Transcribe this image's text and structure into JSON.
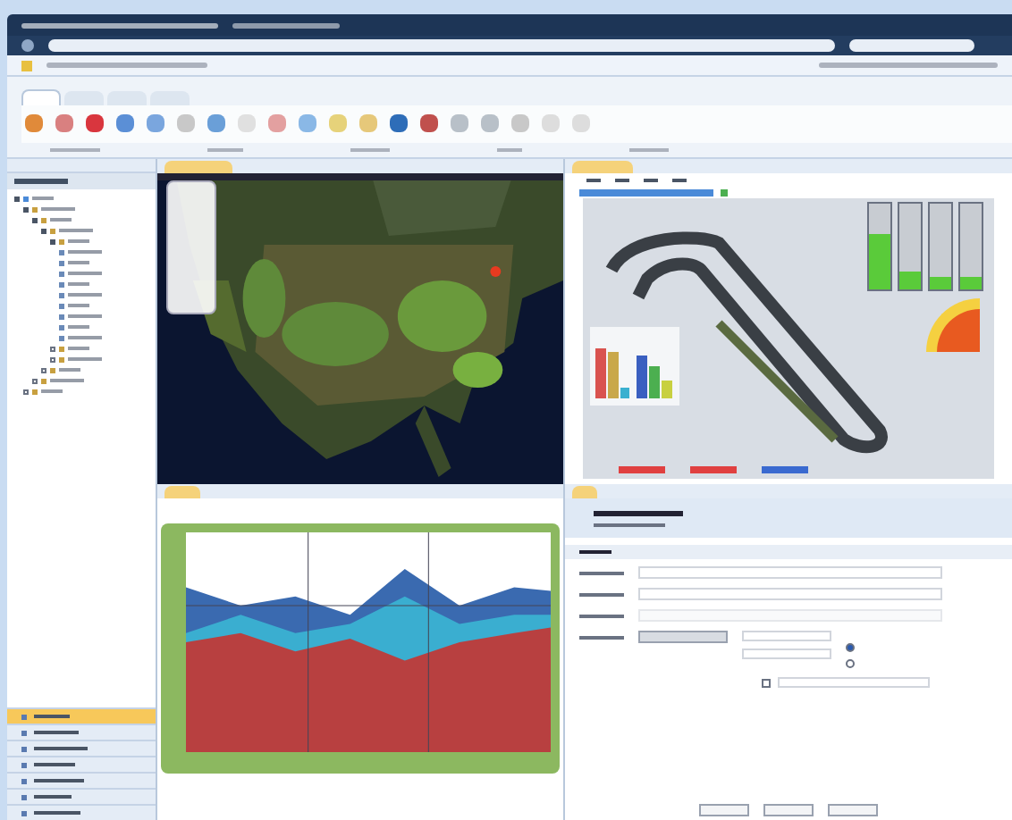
{
  "ribbon": {
    "tabs": [
      {
        "selected": true
      },
      {
        "selected": false
      },
      {
        "selected": false
      },
      {
        "selected": false
      }
    ],
    "buttons": [
      {
        "color": "#e08a3a"
      },
      {
        "color": "#d98080"
      },
      {
        "color": "#d9363e"
      },
      {
        "color": "#5b8fd6"
      },
      {
        "color": "#7aa6de"
      },
      {
        "color": "#c8c8c8"
      },
      {
        "color": "#6a9fd8"
      },
      {
        "color": "#e0e0e0"
      },
      {
        "color": "#e3a0a0"
      },
      {
        "color": "#8ab8e6"
      },
      {
        "color": "#e6d27a"
      },
      {
        "color": "#e6c87a"
      },
      {
        "color": "#2e6db8"
      },
      {
        "color": "#c0504d"
      },
      {
        "color": "#b8c0c8"
      },
      {
        "color": "#b8c0c8"
      },
      {
        "color": "#c8c8c8"
      },
      {
        "color": "#dddddd"
      },
      {
        "color": "#dddddd"
      }
    ]
  },
  "tree": [
    {
      "expanded": true,
      "children": [
        {
          "expanded": true,
          "children": [
            {
              "expanded": true,
              "children": [
                {
                  "expanded": true,
                  "children": [
                    {
                      "expanded": true,
                      "children": [
                        {
                          "kind": "tag"
                        },
                        {
                          "kind": "tag"
                        },
                        {
                          "kind": "tag"
                        },
                        {
                          "kind": "tag"
                        },
                        {
                          "kind": "tag"
                        },
                        {
                          "kind": "tag"
                        },
                        {
                          "kind": "tag"
                        },
                        {
                          "kind": "tag"
                        },
                        {
                          "kind": "tag"
                        }
                      ]
                    },
                    {
                      "expanded": false
                    },
                    {
                      "expanded": false
                    }
                  ]
                },
                {
                  "expanded": false
                }
              ]
            },
            {
              "expanded": false
            }
          ]
        },
        {
          "expanded": false
        }
      ]
    }
  ],
  "nav": [
    {
      "selected": true
    },
    {
      "selected": false
    },
    {
      "selected": false
    },
    {
      "selected": false
    },
    {
      "selected": false
    },
    {
      "selected": false
    },
    {
      "selected": false
    }
  ],
  "gauges": [
    {
      "level": 0.65
    },
    {
      "level": 0.2
    },
    {
      "level": 0.15
    },
    {
      "level": 0.15
    }
  ],
  "form": {
    "options": [
      {
        "selected": true
      },
      {
        "selected": false
      }
    ],
    "checkbox": {
      "checked": false
    }
  }
}
